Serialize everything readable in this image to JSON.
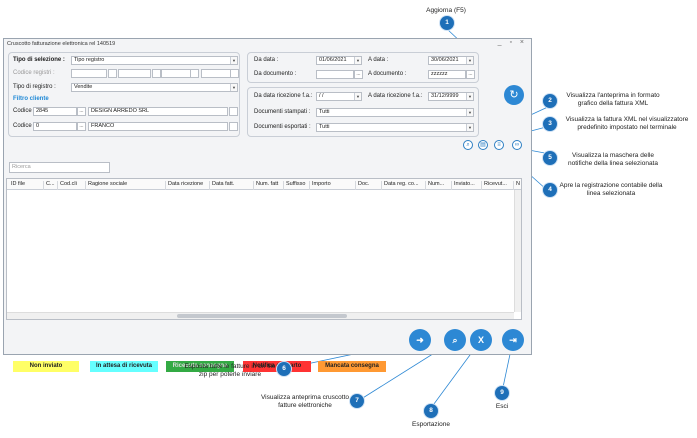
{
  "window": {
    "title": "Cruscotto fatturazione elettronica rel 140519",
    "controls": "_ ▫ ×"
  },
  "filters": {
    "tipo_selezione_label": "Tipo di selezione :",
    "tipo_selezione_value": "Tipo registro",
    "codice_registri_label": "Codice registri :",
    "tipo_registro_label": "Tipo di registro :",
    "tipo_registro_value": "Vendite",
    "filtro_cliente_label": "Filtro cliente",
    "codice_label": "Codice",
    "codice_value": "2845",
    "codice_desc": "DESIGN ARREDO SRL",
    "codice2_label": "Codice",
    "codice2_value": "0",
    "codice2_desc": "FRANCO",
    "ellipsis": "..."
  },
  "dates": {
    "da_data_label": "Da data :",
    "da_data_value": "01/06/2021",
    "a_data_label": "A data :",
    "a_data_value": "30/06/2021",
    "da_documento_label": "Da documento :",
    "a_documento_label": "A documento :",
    "a_documento_value": "zzzzzz",
    "da_ricezione_label": "Da data ricezione f.a.:",
    "da_ricezione_value": "/ /",
    "a_ricezione_label": "A data ricezione f.a.:",
    "a_ricezione_value": "31/12/9999",
    "doc_stampati_label": "Documenti stampati :",
    "doc_stampati_value": "Tutti",
    "doc_esportati_label": "Documenti esportati :",
    "doc_esportati_value": "Tutti"
  },
  "search": {
    "placeholder": "Ricerca"
  },
  "table": {
    "columns": [
      "ID file",
      "C...",
      "Cod.cli",
      "Ragione sociale",
      "Data ricezione",
      "Data fatt.",
      "Num. fatt",
      "Suffisso",
      "Importo",
      "Doc.",
      "Data reg. co...",
      "Num...",
      "Inviato...",
      "Ricevut...",
      "N"
    ]
  },
  "legend": [
    {
      "label": "Non inviato",
      "color": "#ffff66"
    },
    {
      "label": "In attesa di ricevuta",
      "color": "#66ffff"
    },
    {
      "label": "Ricevuta consegna",
      "color": "#33aa44"
    },
    {
      "label": "Notifica di scarto",
      "color": "#ff3333"
    },
    {
      "label": "Mancata consegna",
      "color": "#ff9933"
    }
  ],
  "callouts": {
    "c1": {
      "num": "1",
      "text": "Aggiorna (F5)"
    },
    "c2": {
      "num": "2",
      "text": "Visualizza l'anteprima in formato grafico della fattura XML"
    },
    "c3": {
      "num": "3",
      "text": "Visualizza la fattura XML nel visualizzatore predefinito impostato nel terminale"
    },
    "c4": {
      "num": "4",
      "text": "Apre la registrazione contabile della linea selezionata"
    },
    "c5": {
      "num": "5",
      "text": "Visualizza la maschera delle notifiche della linea selezionata"
    },
    "c6": {
      "num": "6",
      "text": "Esposta tutte le fatture in un file zip per poterle inviare"
    },
    "c7": {
      "num": "7",
      "text": "Visualizza anteprima cruscotto fatture elettroniche"
    },
    "c8": {
      "num": "8",
      "text": "Esportazione"
    },
    "c9": {
      "num": "9",
      "text": "Esci"
    }
  },
  "icons": {
    "refresh": "refresh-icon",
    "export": "export-arrow-icon",
    "preview": "preview-icon",
    "excel": "excel-icon",
    "exit": "exit-icon"
  }
}
